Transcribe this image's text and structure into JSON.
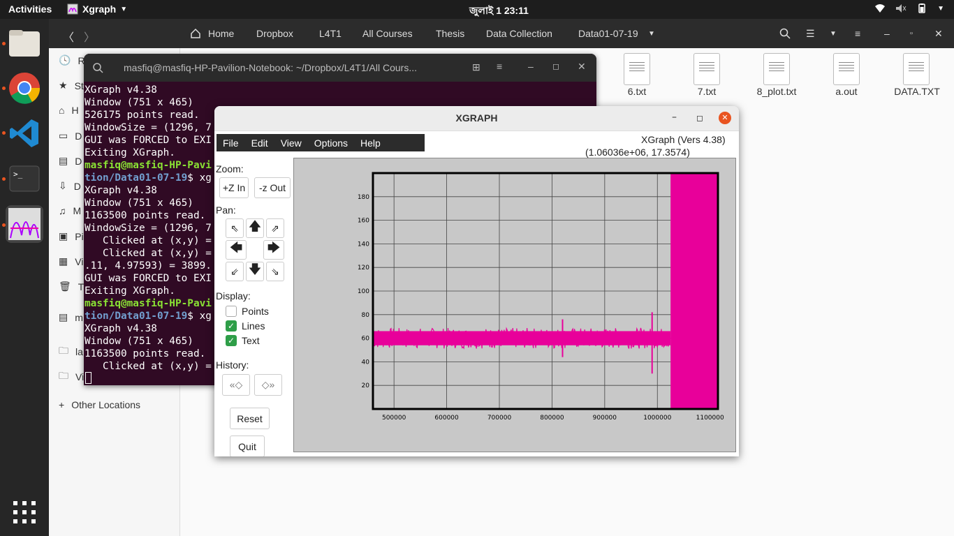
{
  "topbar": {
    "activities": "Activities",
    "app_name": "Xgraph",
    "clock": "জুলাই 1  23:11"
  },
  "files": {
    "breadcrumbs": [
      "Home",
      "Dropbox",
      "L4T1",
      "All Courses",
      "Thesis",
      "Data Collection",
      "Data01-07-19"
    ],
    "sidebar": [
      "Re",
      "St",
      "H",
      "D",
      "D",
      "D",
      "M",
      "Pi",
      "Vi",
      "Tr",
      "m",
      "la",
      "Vi"
    ],
    "other_locations": "Other Locations",
    "items": [
      "6.txt",
      "7.txt",
      "8_plot.txt",
      "a.out",
      "DATA.TXT"
    ]
  },
  "terminal": {
    "title": "masfiq@masfiq-HP-Pavilion-Notebook: ~/Dropbox/L4T1/All Cours...",
    "lines": [
      {
        "t": "XGraph v4.38"
      },
      {
        "t": "Window (751 x 465)"
      },
      {
        "t": "526175 points read."
      },
      {
        "t": "WindowSize = (1296, 7"
      },
      {
        "t": "GUI was FORCED to EXI"
      },
      {
        "t": "Exiting XGraph."
      },
      {
        "g": "masfiq@masfiq-HP-Pavi"
      },
      {
        "b": "tion/Data01-07-19",
        "t": "$ xg"
      },
      {
        "t": "XGraph v4.38"
      },
      {
        "t": "Window (751 x 465)"
      },
      {
        "t": "1163500 points read."
      },
      {
        "t": "WindowSize = (1296, 7"
      },
      {
        "t": "   Clicked at (x,y) ="
      },
      {
        "t": "   Clicked at (x,y) ="
      },
      {
        "t": ".11, 4.97593) = 3899."
      },
      {
        "t": "GUI was FORCED to EXI"
      },
      {
        "t": "Exiting XGraph."
      },
      {
        "g": "masfiq@masfiq-HP-Pavi"
      },
      {
        "b": "tion/Data01-07-19",
        "t": "$ xg"
      },
      {
        "t": "XGraph v4.38"
      },
      {
        "t": "Window (751 x 465)"
      },
      {
        "t": "1163500 points read."
      },
      {
        "t": "   Clicked at (x,y) ="
      }
    ]
  },
  "xgraph": {
    "window_title": "XGRAPH",
    "menu": [
      "File",
      "Edit",
      "View",
      "Options",
      "Help"
    ],
    "version": "XGraph (Vers 4.38)",
    "cursor": "(1.06036e+06, 17.3574)",
    "zoom_label": "Zoom:",
    "zoom_in": "+Z In",
    "zoom_out": "-z Out",
    "pan_label": "Pan:",
    "display_label": "Display:",
    "points_label": "Points",
    "lines_label": "Lines",
    "text_label": "Text",
    "history_label": "History:",
    "reset": "Reset",
    "quit": "Quit",
    "points_checked": false,
    "lines_checked": true,
    "text_checked": true,
    "series_color": "#e8009a",
    "check_color": "#2e9e48"
  },
  "chart_data": {
    "type": "line",
    "series": [
      {
        "values_summary": "dense noise band ~50-70, spikes near 820000 and 990000, saturates to 0-200 after ~1025000"
      }
    ],
    "xlim": [
      460000,
      1115000
    ],
    "ylim": [
      0,
      200
    ],
    "xticks": [
      500000,
      600000,
      700000,
      800000,
      900000,
      1000000,
      1100000
    ],
    "yticks": [
      20,
      40,
      60,
      80,
      100,
      120,
      140,
      160,
      180
    ],
    "band": {
      "x_start": 460000,
      "x_end": 1025000,
      "low": 52,
      "high": 68
    },
    "spikes": [
      {
        "x": 820000,
        "low": 44,
        "high": 76
      },
      {
        "x": 990000,
        "low": 30,
        "high": 82
      }
    ],
    "saturated": {
      "x_start": 1025000,
      "x_end": 1115000,
      "low": 0,
      "high": 200
    }
  }
}
